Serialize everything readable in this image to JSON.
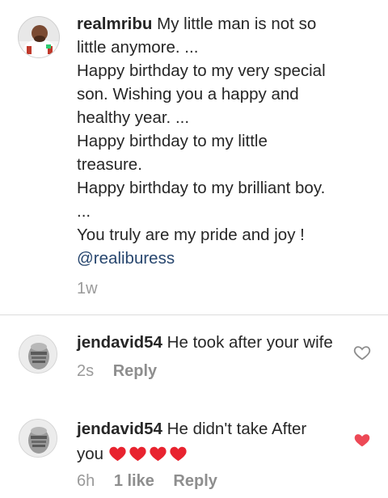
{
  "post": {
    "username": "realmribu",
    "caption_lines": [
      "My little man is not so",
      "little anymore. ...",
      "Happy birthday to my very special",
      "son. Wishing you a happy and",
      "healthy year. ...",
      "Happy birthday to my little",
      "treasure.",
      "Happy birthday to my brilliant boy.",
      "...",
      "You truly are my pride and joy !"
    ],
    "mention": "@realiburess",
    "time": "1w"
  },
  "comments": [
    {
      "username": "jendavid54",
      "text": "He took after your wife",
      "time": "2s",
      "reply_label": "Reply",
      "liked": false
    },
    {
      "username": "jendavid54",
      "text_line1": "He didn't take After",
      "text_line2": "you",
      "time": "6h",
      "likes_label": "1 like",
      "reply_label": "Reply",
      "liked": true
    }
  ],
  "colors": {
    "text": "#262626",
    "meta": "#9a9a9a",
    "mention": "#27466e",
    "heart_red": "#ed4956"
  }
}
